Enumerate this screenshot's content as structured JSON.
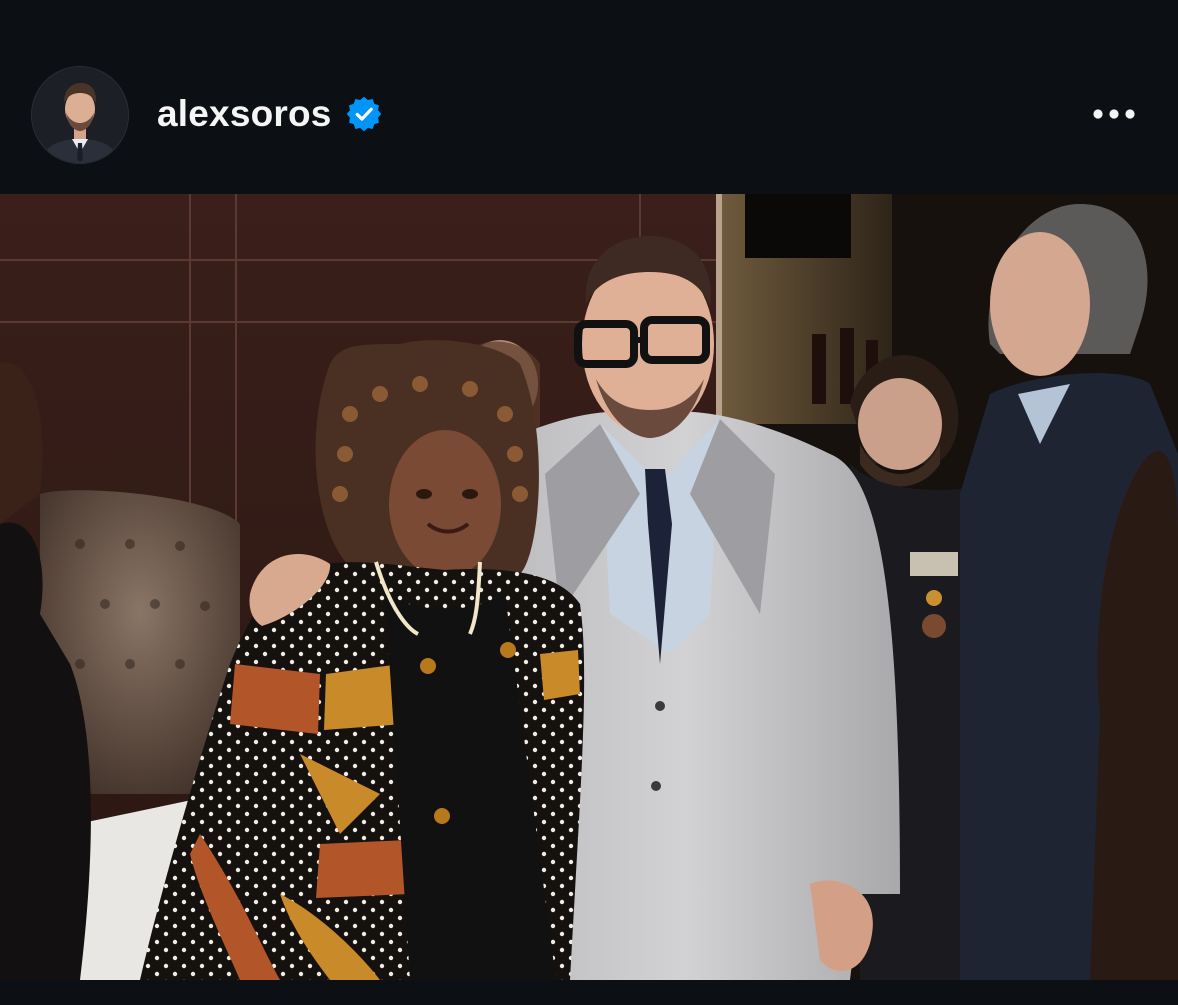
{
  "post": {
    "username": "alexsoros",
    "verified": true,
    "avatar_icon": "profile-avatar",
    "verified_icon": "verified-badge-icon",
    "more_icon": "more-options-icon",
    "photo_icon": "post-photo"
  },
  "colors": {
    "background": "#0c1014",
    "text": "#f5f5f5",
    "verified_blue": "#0095f6"
  }
}
